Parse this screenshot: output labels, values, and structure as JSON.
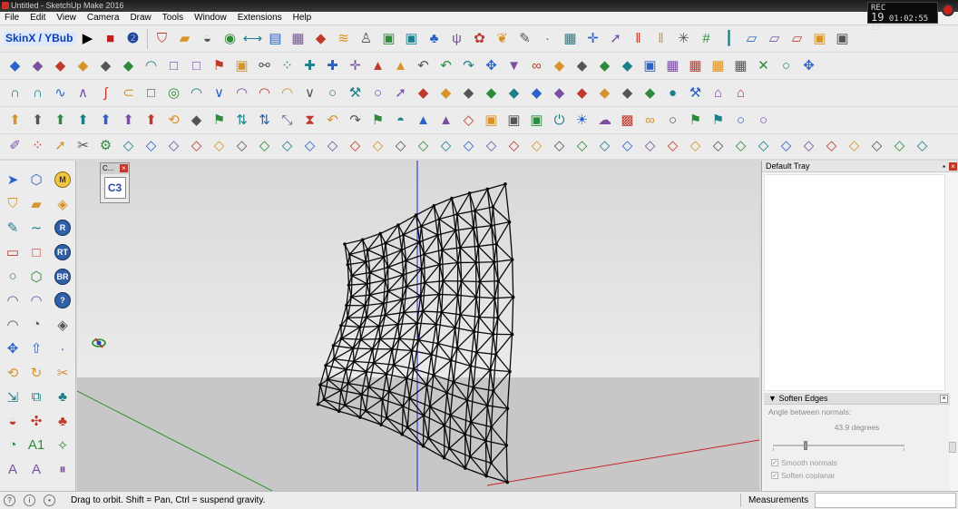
{
  "window": {
    "title": "Untitled - SketchUp Make 2016",
    "clock": {
      "line1": "REC",
      "big": "19",
      "line2": "01:02:55",
      "small": "15"
    }
  },
  "menu": [
    "File",
    "Edit",
    "View",
    "Camera",
    "Draw",
    "Tools",
    "Window",
    "Extensions",
    "Help"
  ],
  "toolbar": {
    "plugin_label": "SkinX / YBub",
    "row1": [
      "bucket-icon",
      "eraser-icon",
      "tape-icon",
      "paint-icon",
      "dim-icon",
      "book-icon",
      "map-icon",
      "cube-icon",
      "layers-icon",
      "figure-icon",
      "box-icon",
      "box-icon",
      "tree-icon",
      "grass-icon",
      "bush-icon",
      "leaf-icon",
      "pin-icon",
      "dot-icon",
      "grid-icon",
      "cross-icon",
      "arrow-icon",
      "bars-icon",
      "bars-icon",
      "star-icon",
      "hash-icon",
      "ruler-icon",
      "plane-icon",
      "plane-icon",
      "plane-icon",
      "box-icon",
      "box-icon"
    ],
    "row2": [
      "cube-icon",
      "cube-icon",
      "cube-icon",
      "cube-icon",
      "cube-icon",
      "cube-icon",
      "arc-icon",
      "square-icon",
      "square-icon",
      "flag-icon",
      "box-icon",
      "link-icon",
      "dots-icon",
      "plus-icon",
      "plus-icon",
      "cross-icon",
      "cone-icon",
      "cone-icon",
      "undo-icon",
      "undo-icon",
      "redo-icon",
      "move-icon",
      "cup-icon",
      "loop-icon",
      "cube-icon",
      "cube-icon",
      "cube-icon",
      "cube-icon",
      "box-icon",
      "grid-icon",
      "grid-icon",
      "grid-icon",
      "grid-icon",
      "x-icon",
      "circle-icon",
      "move-icon"
    ],
    "row3": [
      "curve-icon",
      "curve-icon",
      "wave-icon",
      "n-icon",
      "i-icon",
      "c-icon",
      "square-icon",
      "spiral-icon",
      "arc-icon",
      "v-icon",
      "arc-icon",
      "arc-icon",
      "arc-icon",
      "v-icon",
      "circle-icon",
      "wrench-icon",
      "circle-icon",
      "arrow-icon",
      "cube-icon",
      "cube-icon",
      "cube-icon",
      "cube-icon",
      "cube-icon",
      "cube-icon",
      "cube-icon",
      "cube-icon",
      "cube-icon",
      "cube-icon",
      "cube-icon",
      "info-icon",
      "tools-icon",
      "house-icon",
      "house-icon"
    ],
    "row4": [
      "up-icon",
      "up-icon",
      "up-icon",
      "up-icon",
      "up-icon",
      "up-icon",
      "up-icon",
      "rotate-icon",
      "cube-icon",
      "flag-icon",
      "arrows-icon",
      "arrows-icon",
      "diag-icon",
      "hourglass-icon",
      "undo-icon",
      "redo-icon",
      "flag-icon",
      "shell-icon",
      "cone-icon",
      "cone-icon",
      "shape-icon",
      "box-icon",
      "box-icon",
      "box-icon",
      "power-icon",
      "sun-icon",
      "cloud-icon",
      "film-icon",
      "binoc-icon",
      "circle-icon",
      "flag-icon",
      "flag-icon",
      "circle-icon",
      "circle-icon"
    ],
    "row5": [
      "pen-icon",
      "dots-icon",
      "arrow-icon",
      "cut-icon",
      "gear-icon",
      "shape-icon",
      "shape-icon",
      "shape-icon",
      "shape-icon",
      "shape-icon",
      "shape-icon",
      "shape-icon",
      "shape-icon",
      "shape-icon",
      "shape-icon",
      "shape-icon",
      "shape-icon",
      "shape-icon",
      "shape-icon",
      "shape-icon",
      "shape-icon",
      "shape-icon",
      "shape-icon",
      "shape-icon",
      "shape-icon",
      "shape-icon",
      "shape-icon",
      "shape-icon",
      "shape-icon",
      "shape-icon",
      "shape-icon",
      "shape-icon",
      "shape-icon",
      "shape-icon",
      "shape-icon",
      "shape-icon",
      "shape-icon",
      "shape-icon",
      "shape-icon",
      "shape-icon",
      "shape-icon"
    ]
  },
  "lefttools": {
    "col1": [
      "select-icon",
      "paint-bucket-icon",
      "pencil-icon",
      "rectangle-icon",
      "circle-icon",
      "arc-icon",
      "arc-icon",
      "move-icon",
      "rotate-icon",
      "scale-icon",
      "tape-icon",
      "protractor-icon",
      "text-icon"
    ],
    "col2": [
      "component-icon",
      "eraser-icon",
      "freehand-icon",
      "square-icon",
      "polygon-icon",
      "arc-icon",
      "pie-icon",
      "pushpull-icon",
      "followme-icon",
      "offset-icon",
      "axes-icon",
      "dimension-icon",
      "3dtext-icon"
    ],
    "col3": [
      "M",
      "tag-icon",
      "R",
      "RT",
      "BR",
      "?",
      "tag-icon",
      "dot-icon",
      "scissors-icon",
      "tree-icon",
      "tree-icon",
      "compass-icon",
      "pause-icon"
    ]
  },
  "mini_toolbar": {
    "title": "C...",
    "button": "C3"
  },
  "tray": {
    "title": "Default Tray",
    "soften": {
      "title": "Soften Edges",
      "angle_label": "Angle between normals:",
      "angle_value": "43.9  degrees",
      "slider_fraction": 0.27,
      "smooth_normals": "Smooth normals",
      "soften_coplanar": "Soften coplanar"
    }
  },
  "status": {
    "hint": "Drag to orbit. Shift = Pan, Ctrl = suspend gravity.",
    "measurements_label": "Measurements",
    "measurements_value": ""
  },
  "colors": {
    "axis_blue": "#1b22d6",
    "axis_green": "#2f8f2f",
    "axis_red": "#cc2222",
    "model_edge": "#0a0a0a",
    "plugin_text": "#0b3fae"
  }
}
